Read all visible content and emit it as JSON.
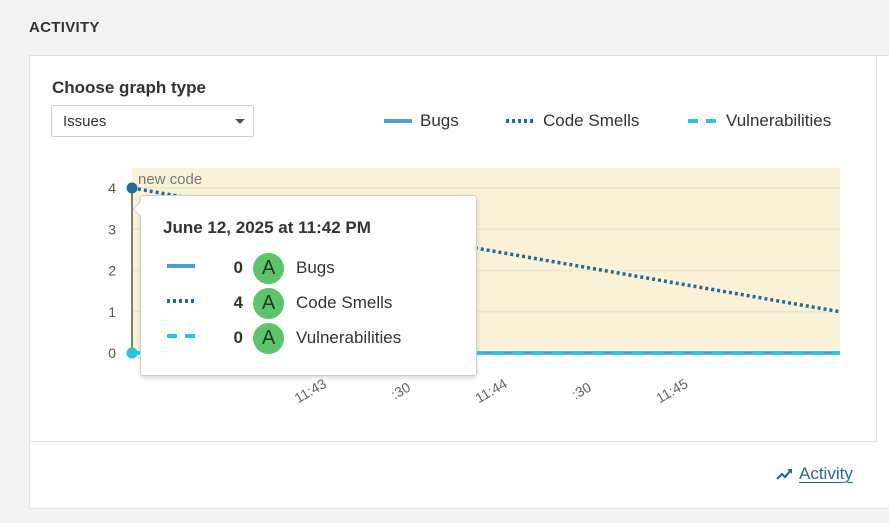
{
  "section_title": "ACTIVITY",
  "graph_type": {
    "label": "Choose graph type",
    "selected": "Issues"
  },
  "legend": [
    {
      "name": "Bugs",
      "style": "solid",
      "color": "#4b9fd5"
    },
    {
      "name": "Code Smells",
      "style": "dotted",
      "color": "#236a97"
    },
    {
      "name": "Vulnerabilities",
      "style": "dashed",
      "color": "#24c6e0"
    }
  ],
  "chart_data": {
    "type": "line",
    "annotation": "new code",
    "y_ticks": [
      "0",
      "1",
      "2",
      "3",
      "4"
    ],
    "ylim": [
      0,
      4
    ],
    "x_ticks": [
      "11:43",
      ":30",
      "11:44",
      ":30",
      "11:45"
    ],
    "series": [
      {
        "name": "Bugs",
        "style": "solid",
        "color": "#4b9fd5",
        "points": [
          {
            "x": "11:42",
            "y": 0
          },
          {
            "x": "11:45:55",
            "y": 0
          }
        ]
      },
      {
        "name": "Code Smells",
        "style": "dotted",
        "color": "#236a97",
        "points": [
          {
            "x": "11:42",
            "y": 4
          },
          {
            "x": "11:45:55",
            "y": 1
          }
        ]
      },
      {
        "name": "Vulnerabilities",
        "style": "dashed",
        "color": "#24c6e0",
        "points": [
          {
            "x": "11:42",
            "y": 0
          },
          {
            "x": "11:45:55",
            "y": 0
          }
        ]
      }
    ],
    "new_code_band_color": "#faf2d7",
    "grid": true
  },
  "tooltip": {
    "date": "June 12, 2025 at 11:42 PM",
    "rows": [
      {
        "value": "0",
        "rating": "A",
        "name": "Bugs",
        "style": "solid",
        "color": "#4b9fd5"
      },
      {
        "value": "4",
        "rating": "A",
        "name": "Code Smells",
        "style": "dotted",
        "color": "#236a97"
      },
      {
        "value": "0",
        "rating": "A",
        "name": "Vulnerabilities",
        "style": "dashed",
        "color": "#24c6e0"
      }
    ]
  },
  "footer": {
    "activity_link": "Activity",
    "link_icon": "trend-line-icon"
  }
}
